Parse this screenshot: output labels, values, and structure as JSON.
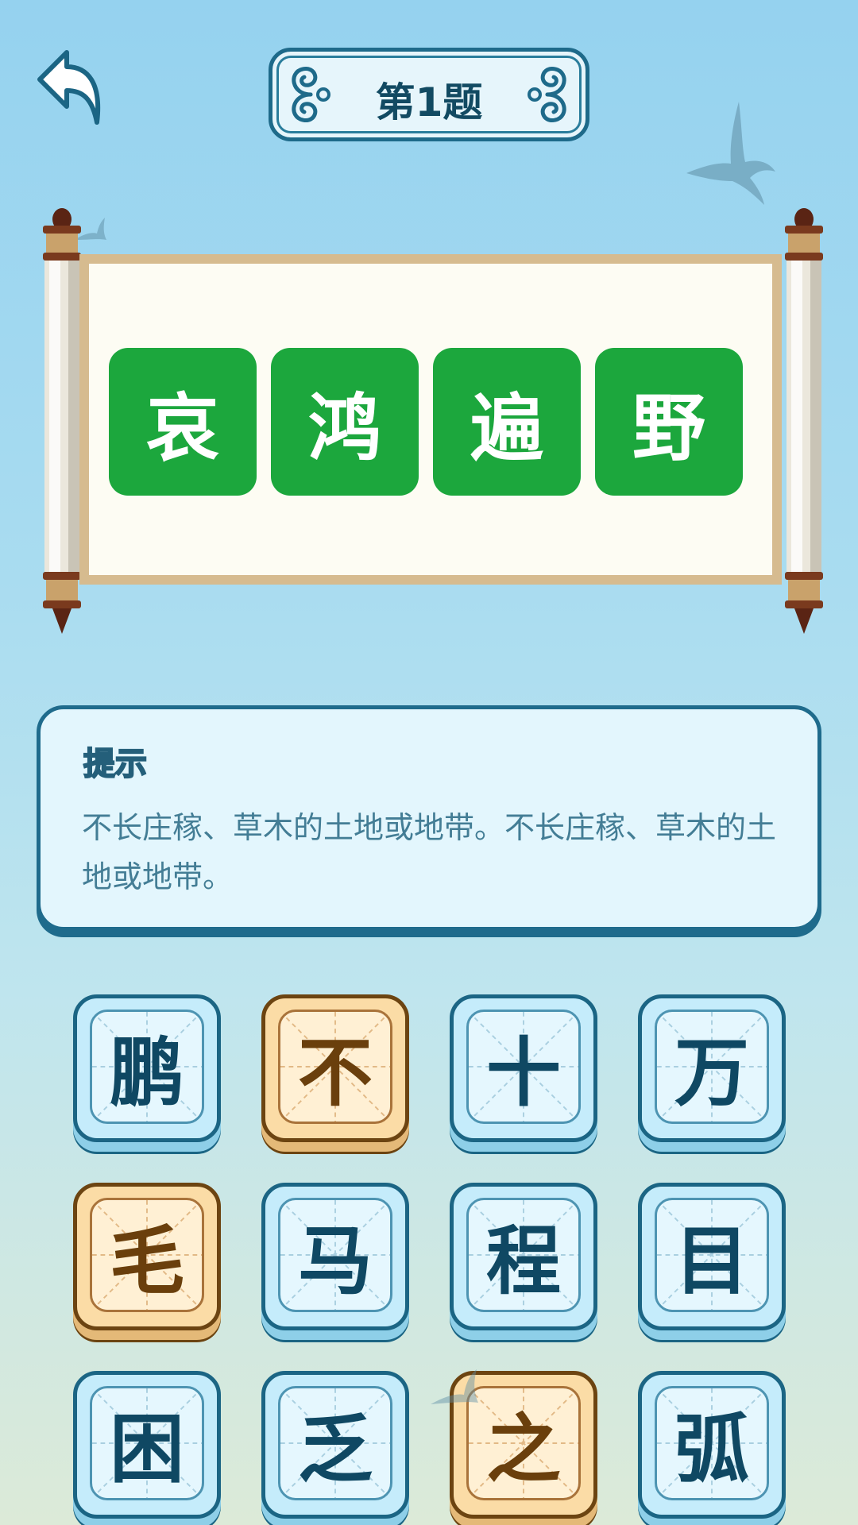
{
  "header": {
    "title": "第1题",
    "back_icon": "back-arrow-icon"
  },
  "answer": {
    "chars": [
      "哀",
      "鸿",
      "遍",
      "野"
    ],
    "tile_color": "#1ca73d"
  },
  "hint": {
    "title": "提示",
    "text": "不长庄稼、草木的土地或地带。不长庄稼、草木的土地或地带。"
  },
  "candidates": {
    "tiles": [
      {
        "char": "鹏",
        "state": "normal"
      },
      {
        "char": "不",
        "state": "selected"
      },
      {
        "char": "十",
        "state": "normal"
      },
      {
        "char": "万",
        "state": "normal"
      },
      {
        "char": "毛",
        "state": "selected"
      },
      {
        "char": "马",
        "state": "normal"
      },
      {
        "char": "程",
        "state": "normal"
      },
      {
        "char": "目",
        "state": "normal"
      },
      {
        "char": "困",
        "state": "normal"
      },
      {
        "char": "乏",
        "state": "normal"
      },
      {
        "char": "之",
        "state": "selected"
      },
      {
        "char": "弧",
        "state": "normal"
      }
    ],
    "normal_color": "#c5ecfb",
    "selected_color": "#fbdca6"
  }
}
